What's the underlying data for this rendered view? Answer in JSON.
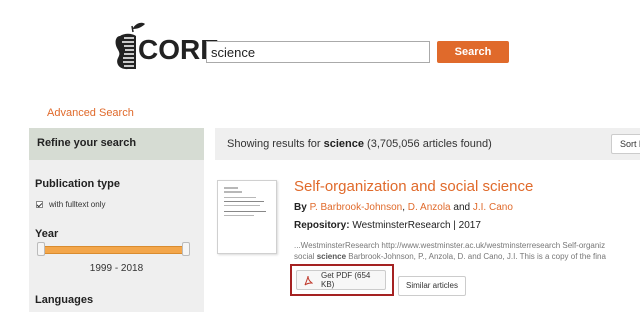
{
  "header": {
    "logo_text": "CORE",
    "search_value": "science",
    "search_button": "Search",
    "advanced_search": "Advanced Search"
  },
  "sidebar": {
    "title": "Refine your search",
    "publication_type": {
      "title": "Publication type",
      "checkbox_label": "with fulltext only",
      "checked": true
    },
    "year": {
      "title": "Year",
      "range": "1999 - 2018"
    },
    "languages_title": "Languages"
  },
  "results": {
    "prefix": "Showing results for ",
    "query": "science",
    "count": "(3,705,056 articles found)",
    "sort_label": "Sort b"
  },
  "result_1": {
    "title": "Self-organization and social science",
    "by_label": "By",
    "authors": [
      "P. Barbrook-Johnson",
      "D. Anzola",
      "J.I. Cano"
    ],
    "author_sep_1": ",",
    "author_sep_2": "and",
    "repo_label": "Repository:",
    "repo_value": "WestminsterResearch | 2017",
    "snippet_line_1": "...WestminsterResearch http://www.westminster.ac.uk/westminsterresearch Self-organiz",
    "snippet_line_2_pre": "social ",
    "snippet_line_2_bold": "science",
    "snippet_line_2_post": " Barbrook-Johnson, P., Anzola, D. and Cano, J.I. This is a copy of the fina",
    "pdf_button": "Get PDF (654 KB)",
    "similar_button": "Similar articles"
  },
  "colors": {
    "accent": "#e06a2b",
    "highlight_border": "#a52222",
    "slider": "#f3a64a"
  },
  "icons": [
    "core-apple-logo-icon",
    "pdf-icon",
    "checkbox-checked-icon"
  ]
}
